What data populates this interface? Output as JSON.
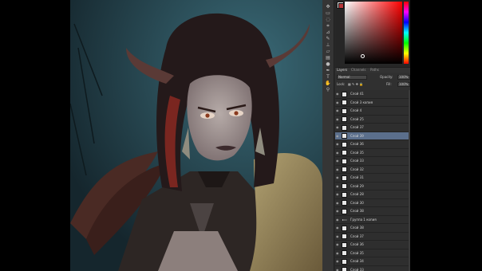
{
  "colors": {
    "foreground": "#e6e6e6",
    "background": "#b8373a",
    "accent_selection": "#5b6f8c"
  },
  "toolbar": {
    "tools": [
      "move-tool",
      "marquee-tool",
      "lasso-tool",
      "crop-tool",
      "eyedropper-tool",
      "brush-tool",
      "stamp-tool",
      "eraser-tool",
      "gradient-tool",
      "dodge-tool",
      "pen-tool",
      "type-tool",
      "hand-tool",
      "zoom-tool"
    ]
  },
  "panel_tabs": [
    "Layers",
    "Channels",
    "Paths"
  ],
  "layer_controls": {
    "blend_mode": "Normal",
    "opacity_label": "Opacity:",
    "opacity": "100%",
    "lock_label": "Lock:",
    "fill_label": "Fill:",
    "fill": "100%"
  },
  "layers": [
    {
      "name": "Слой 41",
      "type": "layer",
      "selected": false
    },
    {
      "name": "Слой 3 копия",
      "type": "layer",
      "selected": false
    },
    {
      "name": "Слой 4",
      "type": "layer",
      "selected": false
    },
    {
      "name": "Слой 25",
      "type": "layer",
      "selected": false
    },
    {
      "name": "Слой 37",
      "type": "layer",
      "selected": false
    },
    {
      "name": "Слой 39",
      "type": "layer",
      "selected": true
    },
    {
      "name": "Слой 36",
      "type": "layer",
      "selected": false
    },
    {
      "name": "Слой 35",
      "type": "layer",
      "selected": false
    },
    {
      "name": "Слой 33",
      "type": "layer",
      "selected": false
    },
    {
      "name": "Слой 32",
      "type": "layer",
      "selected": false
    },
    {
      "name": "Слой 31",
      "type": "layer",
      "selected": false
    },
    {
      "name": "Слой 29",
      "type": "layer",
      "selected": false
    },
    {
      "name": "Слой 28",
      "type": "layer",
      "selected": false
    },
    {
      "name": "Слой 30",
      "type": "layer",
      "selected": false
    },
    {
      "name": "Слой 38",
      "type": "layer",
      "selected": false
    },
    {
      "name": "Группа 1 копия",
      "type": "group",
      "selected": false
    },
    {
      "name": "Слой 38",
      "type": "layer",
      "selected": false
    },
    {
      "name": "Слой 37",
      "type": "layer",
      "selected": false
    },
    {
      "name": "Слой 36",
      "type": "layer",
      "selected": false
    },
    {
      "name": "Слой 35",
      "type": "layer",
      "selected": false
    },
    {
      "name": "Слой 34",
      "type": "layer",
      "selected": false
    },
    {
      "name": "Слой 33",
      "type": "layer",
      "selected": false
    }
  ]
}
